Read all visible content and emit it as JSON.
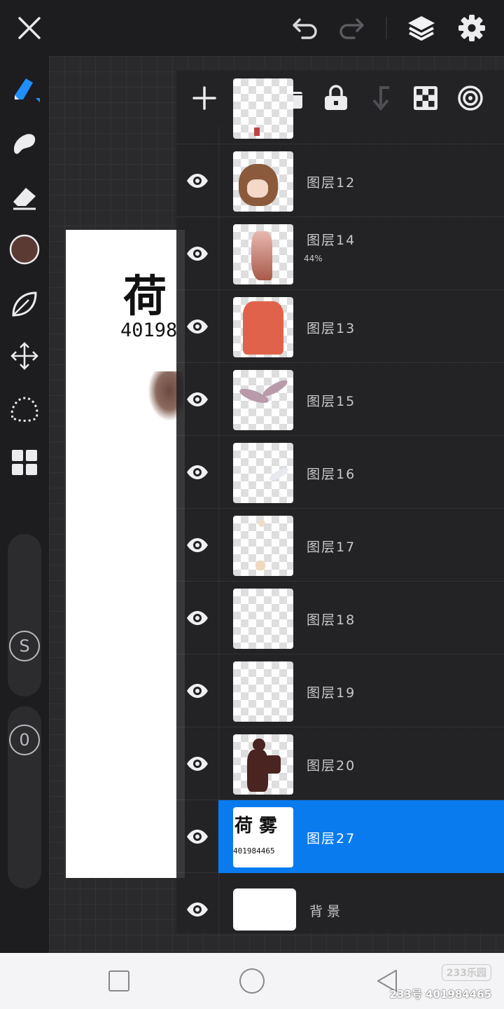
{
  "topbar": {
    "close_icon": "close-icon",
    "undo_icon": "undo-icon",
    "redo_icon": "redo-icon",
    "layers_icon": "layers-icon",
    "settings_icon": "settings-icon"
  },
  "canvas": {
    "paper_name": "荷雾",
    "paper_number": "40198"
  },
  "toolbar": {
    "tools": [
      "brush-tool",
      "smudge-tool",
      "eraser-tool",
      "color-swatch",
      "leaf-tool",
      "move-tool",
      "lasso-tool",
      "gallery-tool"
    ],
    "current_color": "#5a3a33",
    "accent_color": "#1f8fff",
    "size_slider_label": "S",
    "opacity_slider_label": "0"
  },
  "layers_panel": {
    "header_icons": [
      "add-icon",
      "folder-icon",
      "lock-icon",
      "merge-down-icon",
      "transparency-icon",
      "blend-icon"
    ],
    "layers": [
      {
        "name": "图层12",
        "opacity": "",
        "selected": false
      },
      {
        "name": "图层14",
        "opacity": "44%",
        "selected": false
      },
      {
        "name": "图层13",
        "opacity": "",
        "selected": false
      },
      {
        "name": "图层15",
        "opacity": "",
        "selected": false
      },
      {
        "name": "图层16",
        "opacity": "",
        "selected": false
      },
      {
        "name": "图层17",
        "opacity": "",
        "selected": false
      },
      {
        "name": "图层18",
        "opacity": "",
        "selected": false
      },
      {
        "name": "图层19",
        "opacity": "",
        "selected": false
      },
      {
        "name": "图层20",
        "opacity": "",
        "selected": false
      },
      {
        "name": "图层27",
        "opacity": "",
        "selected": true
      },
      {
        "name": "背景",
        "opacity": "",
        "selected": false
      }
    ],
    "thumb27": {
      "line1": "荷 雾",
      "line2": "401984465"
    },
    "selected_color": "#0a7bef"
  },
  "navbar": {
    "recent_icon": "square-icon",
    "home_icon": "circle-icon",
    "back_icon": "triangle-back-icon"
  },
  "watermark": {
    "logo": "233乐园",
    "id": "233号  401984465"
  }
}
